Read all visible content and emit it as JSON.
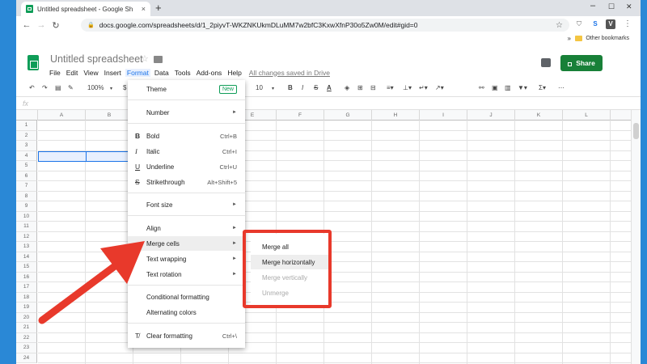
{
  "browser": {
    "tab_title": "Untitled spreadsheet - Google Sh",
    "tab_close": "×",
    "new_tab": "+",
    "url": "docs.google.com/spreadsheets/d/1_2piyvT-WKZNKUkmDLuMM7w2bfC3KxwXfnP30o5Zw0M/edit#gid=0",
    "bookmarks_chevron": "»",
    "other_bookmarks": "Other bookmarks",
    "win_min": "–",
    "win_max": "☐",
    "win_close": "✕"
  },
  "app": {
    "title": "Untitled spreadsheet",
    "menu": [
      "File",
      "Edit",
      "View",
      "Insert",
      "Format",
      "Data",
      "Tools",
      "Add-ons",
      "Help"
    ],
    "active_menu": "Format",
    "saved_status": "All changes saved in Drive",
    "share_label": "Share",
    "zoom": "100%",
    "font_size": "10",
    "fx_label": "fx"
  },
  "grid": {
    "columns": [
      "A",
      "B",
      "C",
      "D",
      "E",
      "F",
      "G",
      "H",
      "I",
      "J",
      "K",
      "L"
    ],
    "rows": [
      "1",
      "2",
      "3",
      "4",
      "5",
      "6",
      "7",
      "8",
      "9",
      "10",
      "11",
      "12",
      "13",
      "14",
      "15",
      "16",
      "17",
      "18",
      "19",
      "20",
      "21",
      "22",
      "23",
      "24"
    ]
  },
  "format_menu": {
    "theme": "Theme",
    "theme_badge": "New",
    "number": "Number",
    "bold": "Bold",
    "bold_sc": "Ctrl+B",
    "italic": "Italic",
    "italic_sc": "Ctrl+I",
    "underline": "Underline",
    "underline_sc": "Ctrl+U",
    "strikethrough": "Strikethrough",
    "strikethrough_sc": "Alt+Shift+5",
    "font_size": "Font size",
    "align": "Align",
    "merge_cells": "Merge cells",
    "text_wrapping": "Text wrapping",
    "text_rotation": "Text rotation",
    "conditional_formatting": "Conditional formatting",
    "alternating_colors": "Alternating colors",
    "clear_formatting": "Clear formatting",
    "clear_formatting_sc": "Ctrl+\\"
  },
  "merge_submenu": {
    "merge_all": "Merge all",
    "merge_horizontally": "Merge horizontally",
    "merge_vertically": "Merge vertically",
    "unmerge": "Unmerge"
  },
  "annotation": {
    "arrow_color": "#e8392b",
    "box_color": "#e8392b"
  }
}
